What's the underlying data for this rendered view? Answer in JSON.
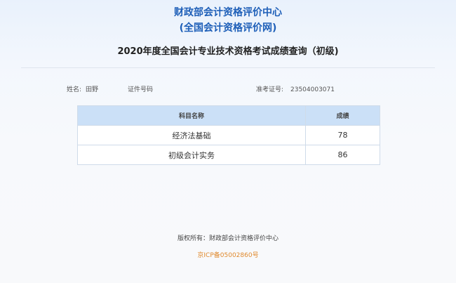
{
  "header": {
    "title_line1": "财政部会计资格评价中心",
    "title_line2": "(全国会计资格评价网)",
    "query_title": "2020年度全国会计专业技术资格考试成绩查询（初级)"
  },
  "info": {
    "name_label": "姓名:",
    "name_value": "田野",
    "id_label": "证件号码",
    "cert_label": "准考证号:",
    "cert_value": "23504003071"
  },
  "table": {
    "headers": [
      "科目名称",
      "成绩"
    ],
    "rows": [
      {
        "subject": "经济法基础",
        "score": "78"
      },
      {
        "subject": "初级会计实务",
        "score": "86"
      }
    ]
  },
  "footer": {
    "copyright": "版权所有：财政部会计资格评价中心",
    "icp": "京ICP备05002860号"
  },
  "colors": {
    "brand_blue": "#1e5fb8",
    "table_header_bg": "#cbe0f7",
    "icp_orange": "#e08a2e"
  }
}
